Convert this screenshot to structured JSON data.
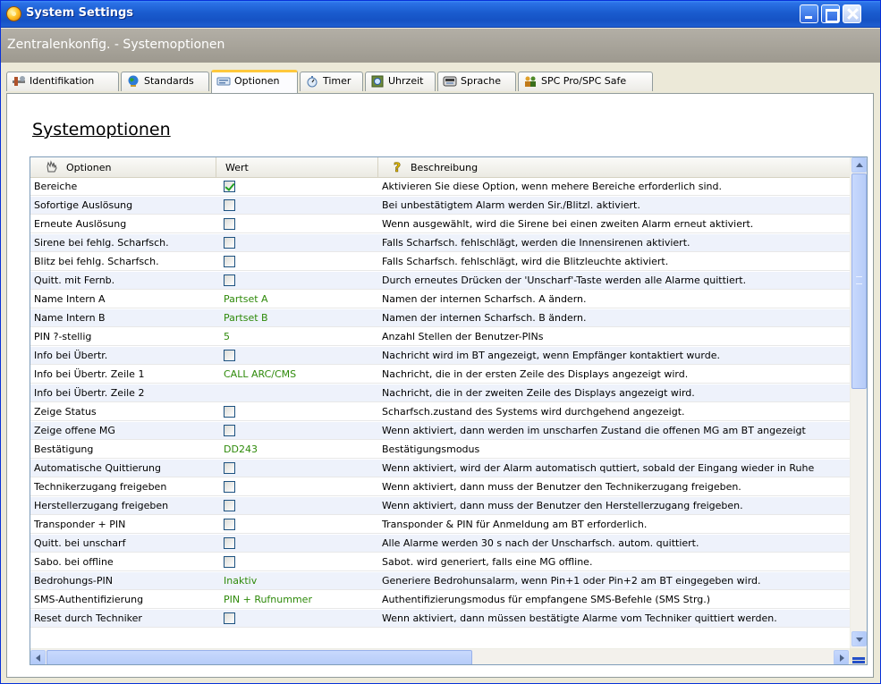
{
  "window": {
    "title": "System Settings",
    "header": "Zentralenkonfig. - Systemoptionen"
  },
  "tabs": [
    {
      "label": "Identifikation",
      "icon": "tools-icon"
    },
    {
      "label": "Standards",
      "icon": "globe-icon"
    },
    {
      "label": "Optionen",
      "icon": "options-icon",
      "active": true
    },
    {
      "label": "Timer",
      "icon": "timer-icon"
    },
    {
      "label": "Uhrzeit",
      "icon": "clock-icon"
    },
    {
      "label": "Sprache",
      "icon": "language-icon"
    },
    {
      "label": "SPC Pro/SPC Safe",
      "icon": "people-icon"
    }
  ],
  "page_title": "Systemoptionen",
  "grid": {
    "columns": {
      "options": "Optionen",
      "value": "Wert",
      "description": "Beschreibung"
    },
    "rows": [
      {
        "option": "Bereiche",
        "checkbox": true,
        "checked": true,
        "description": "Aktivieren Sie diese Option, wenn mehere Bereiche erforderlich sind."
      },
      {
        "option": "Sofortige Auslösung",
        "checkbox": true,
        "checked": false,
        "description": "Bei unbestätigtem Alarm werden Sir./Blitzl. aktiviert."
      },
      {
        "option": "Erneute Auslösung",
        "checkbox": true,
        "checked": false,
        "description": "Wenn ausgewählt, wird die Sirene bei einen zweiten Alarm erneut aktiviert."
      },
      {
        "option": "Sirene bei fehlg. Scharfsch.",
        "checkbox": true,
        "checked": false,
        "description": "Falls Scharfsch. fehlschlägt, werden die Innensirenen aktiviert."
      },
      {
        "option": "Blitz bei fehlg. Scharfsch.",
        "checkbox": true,
        "checked": false,
        "description": "Falls Scharfsch. fehlschlägt, wird die Blitzleuchte aktiviert."
      },
      {
        "option": "Quitt. mit Fernb.",
        "checkbox": true,
        "checked": false,
        "description": "Durch erneutes Drücken der 'Unscharf'-Taste werden alle Alarme quittiert."
      },
      {
        "option": "Name Intern A",
        "value": "Partset A",
        "description": "Namen der internen Scharfsch. A ändern."
      },
      {
        "option": "Name Intern B",
        "value": "Partset B",
        "description": "Namen der internen Scharfsch. B ändern."
      },
      {
        "option": "PIN ?-stellig",
        "value": "5",
        "description": "Anzahl Stellen der Benutzer-PINs"
      },
      {
        "option": "Info bei Übertr.",
        "checkbox": true,
        "checked": false,
        "description": "Nachricht wird im BT angezeigt, wenn Empfänger kontaktiert wurde."
      },
      {
        "option": "Info bei Übertr. Zeile 1",
        "value": "CALL ARC/CMS",
        "description": "Nachricht, die in der ersten Zeile des Displays angezeigt wird."
      },
      {
        "option": "Info bei Übertr. Zeile 2",
        "value": "",
        "description": "Nachricht, die in der zweiten Zeile des Displays angezeigt wird."
      },
      {
        "option": "Zeige Status",
        "checkbox": true,
        "checked": false,
        "description": "Scharfsch.zustand des Systems wird durchgehend angezeigt."
      },
      {
        "option": "Zeige offene MG",
        "checkbox": true,
        "checked": false,
        "description": "Wenn aktiviert, dann werden im unscharfen Zustand die offenen MG am BT angezeigt"
      },
      {
        "option": "Bestätigung",
        "value": "DD243",
        "description": "Bestätigungsmodus"
      },
      {
        "option": "Automatische Quittierung",
        "checkbox": true,
        "checked": false,
        "description": "Wenn aktiviert, wird der Alarm automatisch quttiert, sobald der Eingang wieder in Ruhe"
      },
      {
        "option": "Technikerzugang freigeben",
        "checkbox": true,
        "checked": false,
        "description": "Wenn aktiviert, dann muss der Benutzer den Technikerzugang freigeben."
      },
      {
        "option": "Herstellerzugang freigeben",
        "checkbox": true,
        "checked": false,
        "description": "Wenn aktiviert, dann muss der Benutzer den Herstellerzugang freigeben."
      },
      {
        "option": "Transponder + PIN",
        "checkbox": true,
        "checked": false,
        "description": "Transponder & PIN für Anmeldung am BT erforderlich."
      },
      {
        "option": "Quitt. bei unscharf",
        "checkbox": true,
        "checked": false,
        "description": "Alle Alarme werden 30 s nach der Unscharfsch. autom. quittiert."
      },
      {
        "option": "Sabo. bei offline",
        "checkbox": true,
        "checked": false,
        "description": "Sabot. wird generiert, falls eine MG offline."
      },
      {
        "option": "Bedrohungs-PIN",
        "value": "Inaktiv",
        "description": "Generiere Bedrohunsalarm, wenn Pin+1 oder Pin+2 am BT eingegeben wird."
      },
      {
        "option": "SMS-Authentifizierung",
        "value": "PIN + Rufnummer",
        "description": "Authentifizierungsmodus für empfangene SMS-Befehle (SMS Strg.)"
      },
      {
        "option": "Reset durch Techniker",
        "checkbox": true,
        "checked": false,
        "description": "Wenn aktiviert, dann müssen bestätigte Alarme vom Techniker quittiert werden."
      }
    ]
  },
  "colors": {
    "title_bar": "#1a5ccf",
    "header_band": "#a6a298",
    "value_text": "#2e8a0a",
    "active_tab_accent": "#ffc83c",
    "row_alt": "#eef2fb"
  }
}
